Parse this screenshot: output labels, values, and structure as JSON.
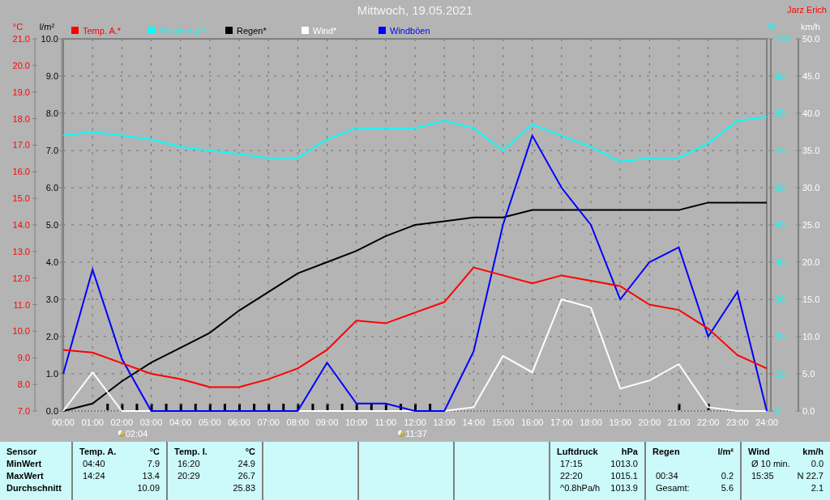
{
  "title": "Mittwoch, 19.05.2021",
  "owner": "Jarz Erich",
  "temperature_chart": {
    "chart_data": {
      "type": "line",
      "legend": "top",
      "ylabel": "°C",
      "ylim": [
        7,
        21
      ],
      "yticks": [
        {
          "value": 21,
          "label": "21.0"
        },
        {
          "value": 20,
          "label": "20.0"
        },
        {
          "value": 19,
          "label": "19.0"
        },
        {
          "value": 18,
          "label": "18.0"
        },
        {
          "value": 17,
          "label": "17.0"
        },
        {
          "value": 16,
          "label": "16.0"
        },
        {
          "value": 15,
          "label": "15.0"
        },
        {
          "value": 14,
          "label": "14.0"
        },
        {
          "value": 13,
          "label": "13.0"
        },
        {
          "value": 12,
          "label": "12.0"
        },
        {
          "value": 11,
          "label": "11.0"
        },
        {
          "value": 10,
          "label": "10.0"
        },
        {
          "value": 9,
          "label": "9.0"
        },
        {
          "value": 8,
          "label": "8.0"
        },
        {
          "value": 7,
          "label": "7.0"
        }
      ],
      "y2label": "%",
      "y2lim": [
        0,
        100
      ],
      "y2ticks": [
        100,
        90,
        80,
        70,
        60,
        50,
        40,
        30,
        20,
        10,
        0
      ],
      "series": [
        {
          "name": "Temp. A.*",
          "color": "#ff0000",
          "values": [
            9.3,
            9.2,
            8.8,
            8.4,
            8.2,
            7.9,
            7.9,
            8.2,
            8.6,
            9.3,
            10.4,
            10.3,
            10.7,
            11.1,
            12.4,
            12.1,
            11.8,
            12.1,
            11.9,
            11.7,
            11.0,
            10.8,
            10.1,
            9.1,
            8.6
          ]
        },
        {
          "name": "Feuchte A.*",
          "color": "#00ffff",
          "axis": "y2",
          "values": [
            74,
            75,
            74,
            73,
            71,
            70,
            69,
            68,
            68,
            73,
            76,
            76,
            76,
            78,
            76,
            70,
            77,
            74,
            71,
            67,
            68,
            68,
            72,
            78,
            79
          ]
        }
      ]
    }
  },
  "rain_wind_chart": {
    "chart_data": {
      "type": "line",
      "legend": "top",
      "grid": true,
      "x": [
        "00:00",
        "01:00",
        "02:00",
        "03:00",
        "04:00",
        "05:00",
        "06:00",
        "07:00",
        "08:00",
        "09:00",
        "10:00",
        "11:00",
        "12:00",
        "13:00",
        "14:00",
        "15:00",
        "16:00",
        "17:00",
        "18:00",
        "19:00",
        "20:00",
        "21:00",
        "22:00",
        "23:00",
        "24:00"
      ],
      "ylabel": "l/m²",
      "ylim": [
        0,
        10
      ],
      "yticks": [
        {
          "value": 10,
          "label": "10.0"
        },
        {
          "value": 9,
          "label": "9.0"
        },
        {
          "value": 8,
          "label": "8.0"
        },
        {
          "value": 7,
          "label": "7.0"
        },
        {
          "value": 6,
          "label": "6.0"
        },
        {
          "value": 5,
          "label": "5.0"
        },
        {
          "value": 4,
          "label": "4.0"
        },
        {
          "value": 3,
          "label": "3.0"
        },
        {
          "value": 2,
          "label": "2.0"
        },
        {
          "value": 1,
          "label": "1.0"
        },
        {
          "value": 0,
          "label": "0.0"
        }
      ],
      "y2label": "km/h",
      "y2lim": [
        0,
        50
      ],
      "y2ticks": [
        {
          "value": 50,
          "label": "50.0"
        },
        {
          "value": 45,
          "label": "45.0"
        },
        {
          "value": 40,
          "label": "40.0"
        },
        {
          "value": 35,
          "label": "35.0"
        },
        {
          "value": 30,
          "label": "30.0"
        },
        {
          "value": 25,
          "label": "25.0"
        },
        {
          "value": 20,
          "label": "20.0"
        },
        {
          "value": 15,
          "label": "15.0"
        },
        {
          "value": 10,
          "label": "10.0"
        },
        {
          "value": 5,
          "label": "5.0"
        },
        {
          "value": 0,
          "label": "0.0"
        }
      ],
      "series": [
        {
          "name": "Regen*",
          "color": "#000000",
          "values": [
            0,
            0.2,
            0.8,
            1.3,
            1.7,
            2.1,
            2.7,
            3.2,
            3.7,
            4.0,
            4.3,
            4.7,
            5.0,
            5.1,
            5.2,
            5.2,
            5.4,
            5.4,
            5.4,
            5.4,
            5.4,
            5.4,
            5.6,
            5.6,
            5.6
          ]
        },
        {
          "name": "Wind*",
          "color": "#ffffff",
          "axis": "y2",
          "values": [
            0,
            5.2,
            0,
            0,
            0,
            0,
            0,
            0,
            0,
            0,
            0,
            0,
            0,
            0,
            0.5,
            7.4,
            5.2,
            15,
            13.9,
            3,
            4.1,
            6.3,
            0.5,
            0,
            0
          ]
        },
        {
          "name": "Windböen",
          "color": "#0000ff",
          "axis": "y2",
          "values": [
            5,
            19,
            7,
            0,
            0,
            0,
            0,
            0,
            0,
            6.5,
            1,
            1,
            0,
            0,
            8,
            25,
            37,
            30,
            25,
            15,
            20,
            22,
            10,
            16,
            0
          ]
        }
      ]
    }
  },
  "sun_markers": [
    {
      "time": "02:04"
    },
    {
      "time": "11:37"
    }
  ],
  "stats": {
    "labels": [
      "Sensor",
      "MinWert",
      "MaxWert",
      "Durchschnitt"
    ],
    "panels": [
      {
        "kind": "data",
        "title": "Temp. A.",
        "unit": "°C",
        "rows": [
          {
            "time": "04:40",
            "value": "7.9"
          },
          {
            "time": "14:24",
            "value": "13.4"
          },
          {
            "value": "10.09"
          }
        ]
      },
      {
        "kind": "data",
        "title": "Temp. I.",
        "unit": "°C",
        "rows": [
          {
            "time": "16:20",
            "value": "24.9"
          },
          {
            "time": "20:29",
            "value": "26.7"
          },
          {
            "value": "25.83"
          }
        ]
      },
      {
        "kind": "empty"
      },
      {
        "kind": "empty"
      },
      {
        "kind": "empty"
      },
      {
        "kind": "data",
        "title": "Luftdruck",
        "unit": "hPa",
        "rows": [
          {
            "time": "17:15",
            "value": "1013.0"
          },
          {
            "time": "22:20",
            "value": "1015.1"
          },
          {
            "time": "^0.8hPa/h",
            "value": "1013.9"
          }
        ]
      },
      {
        "kind": "data",
        "title": "Regen",
        "unit": "l/m²",
        "rows": [
          {},
          {
            "time": "00:34",
            "value": "0.2"
          },
          {
            "time": "Gesamt:",
            "value": "5.6"
          }
        ]
      },
      {
        "kind": "data",
        "title": "Wind",
        "unit": "km/h",
        "rows": [
          {
            "time": "Ø 10 min.",
            "value": "0.0"
          },
          {
            "time": "15:35",
            "value": "N 22.7"
          },
          {
            "value": "2.1"
          }
        ]
      }
    ]
  }
}
